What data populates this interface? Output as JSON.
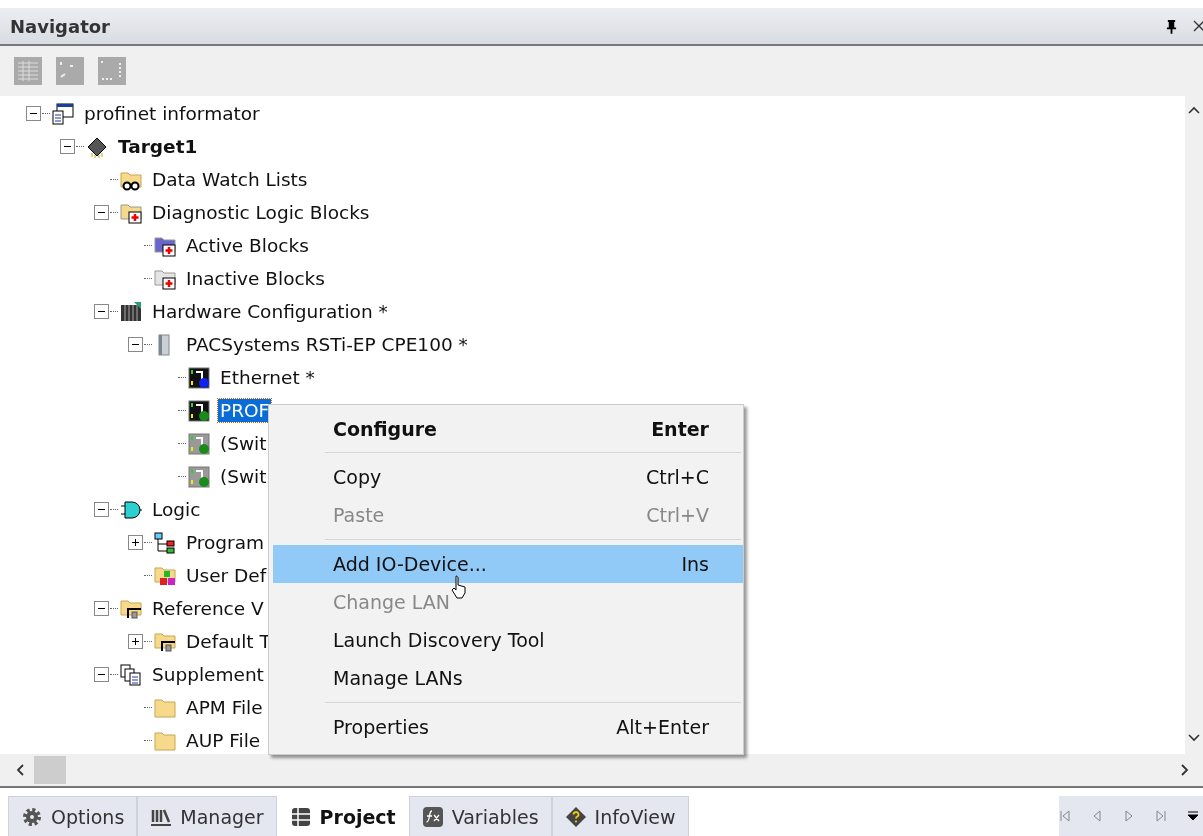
{
  "panel": {
    "title": "Navigator"
  },
  "tree": [
    {
      "label": "profinet informator",
      "kind": "project",
      "active": false,
      "selected": false,
      "expanded": true,
      "children": [
        {
          "label": "Target1",
          "kind": "target",
          "active": true,
          "selected": false,
          "expanded": true,
          "children": [
            {
              "label": "Data Watch Lists",
              "kind": "watch",
              "active": false,
              "selected": false
            },
            {
              "label": "Diagnostic Logic Blocks",
              "kind": "diag",
              "active": false,
              "selected": false,
              "expanded": true,
              "children": [
                {
                  "label": "Active Blocks",
                  "kind": "active-block",
                  "active": false,
                  "selected": false
                },
                {
                  "label": "Inactive Blocks",
                  "kind": "inactive-block",
                  "active": false,
                  "selected": false
                }
              ]
            },
            {
              "label": "Hardware Configuration *",
              "kind": "hardware",
              "active": false,
              "selected": false,
              "expanded": true,
              "children": [
                {
                  "label": "PACSystems RSTi-EP CPE100 *",
                  "kind": "cpu",
                  "active": false,
                  "selected": false,
                  "expanded": true,
                  "children": [
                    {
                      "label": "Ethernet *",
                      "kind": "port-1",
                      "active": false,
                      "selected": false
                    },
                    {
                      "label": "PROF",
                      "kind": "port-2",
                      "active": false,
                      "selected": true
                    },
                    {
                      "label": "(Swit",
                      "kind": "port-grey",
                      "active": false,
                      "selected": false
                    },
                    {
                      "label": "(Swit",
                      "kind": "port-grey",
                      "active": false,
                      "selected": false
                    }
                  ]
                }
              ]
            },
            {
              "label": "Logic",
              "kind": "logic",
              "active": false,
              "selected": false,
              "expanded": true,
              "children": [
                {
                  "label": "Program",
                  "kind": "program",
                  "active": false,
                  "selected": false,
                  "expanded": false
                },
                {
                  "label": "User Def",
                  "kind": "udt",
                  "active": false,
                  "selected": false
                }
              ]
            },
            {
              "label": "Reference V",
              "kind": "ref",
              "active": false,
              "selected": false,
              "expanded": true,
              "children": [
                {
                  "label": "Default T",
                  "kind": "ref",
                  "active": false,
                  "selected": false,
                  "expanded": false
                }
              ]
            },
            {
              "label": "Supplement",
              "kind": "supplement",
              "active": false,
              "selected": false,
              "expanded": true,
              "children": [
                {
                  "label": "APM File",
                  "kind": "folder",
                  "active": false,
                  "selected": false
                },
                {
                  "label": "AUP File",
                  "kind": "folder",
                  "active": false,
                  "selected": false
                }
              ]
            }
          ]
        }
      ]
    }
  ],
  "context_menu": [
    {
      "kind": "item",
      "label": "Configure",
      "shortcut": "Enter",
      "default": true,
      "disabled": false,
      "selected": false
    },
    {
      "kind": "separator"
    },
    {
      "kind": "item",
      "label": "Copy",
      "shortcut": "Ctrl+C",
      "default": false,
      "disabled": false,
      "selected": false
    },
    {
      "kind": "item",
      "label": "Paste",
      "shortcut": "Ctrl+V",
      "default": false,
      "disabled": true,
      "selected": false
    },
    {
      "kind": "separator"
    },
    {
      "kind": "item",
      "label": "Add IO-Device...",
      "shortcut": "Ins",
      "default": false,
      "disabled": false,
      "selected": true
    },
    {
      "kind": "item",
      "label": "Change LAN",
      "default": false,
      "disabled": true,
      "selected": false
    },
    {
      "kind": "item",
      "label": "Launch Discovery Tool",
      "default": false,
      "disabled": false,
      "selected": false
    },
    {
      "kind": "item",
      "label": "Manage LANs",
      "default": false,
      "disabled": false,
      "selected": false
    },
    {
      "kind": "separator"
    },
    {
      "kind": "item",
      "label": "Properties",
      "shortcut": "Alt+Enter",
      "default": false,
      "disabled": false,
      "selected": false
    }
  ],
  "bottom_tabs": [
    {
      "label": "Options",
      "kind": "options",
      "selected": false
    },
    {
      "label": "Manager",
      "kind": "manager",
      "selected": false
    },
    {
      "label": "Project",
      "kind": "project",
      "selected": true
    },
    {
      "label": "Variables",
      "kind": "variables",
      "selected": false
    },
    {
      "label": "InfoView",
      "kind": "infoview",
      "selected": false
    }
  ]
}
